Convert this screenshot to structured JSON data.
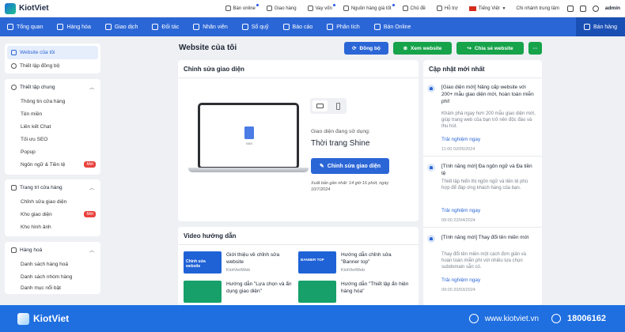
{
  "app": {
    "brand": "KiotViet"
  },
  "topbar": {
    "links": [
      {
        "label": "Bán online",
        "icon": "shop-icon",
        "dot": true
      },
      {
        "label": "Giao hàng",
        "icon": "truck-icon",
        "dot": false
      },
      {
        "label": "Vay vốn",
        "icon": "money-icon",
        "dot": true
      },
      {
        "label": "Nguồn hàng giá tốt",
        "icon": "source-icon",
        "dot": true
      },
      {
        "label": "Chủ đề",
        "icon": "palette-icon",
        "dot": false
      },
      {
        "label": "Hỗ trợ",
        "icon": "support-icon",
        "dot": false
      },
      {
        "label": "Tiếng Việt",
        "icon": "flag-vn-icon",
        "dot": false
      }
    ],
    "branch": "Chi nhánh trung tâm",
    "user": "admin"
  },
  "nav": {
    "items": [
      {
        "label": "Tổng quan",
        "icon": "eye-icon"
      },
      {
        "label": "Hàng hóa",
        "icon": "box-icon"
      },
      {
        "label": "Giao dịch",
        "icon": "transfer-icon"
      },
      {
        "label": "Đối tác",
        "icon": "partner-icon"
      },
      {
        "label": "Nhân viên",
        "icon": "staff-icon"
      },
      {
        "label": "Sổ quỹ",
        "icon": "wallet-icon"
      },
      {
        "label": "Báo cáo",
        "icon": "report-icon"
      },
      {
        "label": "Phân tích",
        "icon": "analytics-icon"
      },
      {
        "label": "Bán Online",
        "icon": "cart-icon"
      }
    ],
    "sell_button": "Bán hàng"
  },
  "sidebar": {
    "top_items": [
      {
        "label": "Website của tôi",
        "active": true
      },
      {
        "label": "Thiết lập đồng bộ",
        "active": false
      }
    ],
    "groups": [
      {
        "title": "Thiết lập chung",
        "items": [
          {
            "label": "Thông tin cửa hàng",
            "badge": ""
          },
          {
            "label": "Tên miền",
            "badge": ""
          },
          {
            "label": "Liên kết Chat",
            "badge": ""
          },
          {
            "label": "Tối ưu SEO",
            "badge": ""
          },
          {
            "label": "Popup",
            "badge": ""
          },
          {
            "label": "Ngôn ngữ & Tiền tệ",
            "badge": "Mới"
          }
        ]
      },
      {
        "title": "Trang trí cửa hàng",
        "items": [
          {
            "label": "Chỉnh sửa giao diện",
            "badge": ""
          },
          {
            "label": "Kho giao diện",
            "badge": "Mới"
          },
          {
            "label": "Kho hình ảnh",
            "badge": ""
          }
        ]
      },
      {
        "title": "Hàng hoá",
        "items": [
          {
            "label": "Danh sách hàng hoá",
            "badge": ""
          },
          {
            "label": "Danh sách nhóm hàng",
            "badge": ""
          },
          {
            "label": "Danh mục nổi bật",
            "badge": ""
          }
        ]
      }
    ]
  },
  "main": {
    "title": "Website của tôi",
    "buttons": {
      "sync": "Đồng bộ",
      "view": "Xem website",
      "share": "Chia sẻ website",
      "more": "···"
    },
    "editor": {
      "title": "Chỉnh sửa giao diện",
      "current_label": "Giao diện đang sử dụng:",
      "theme_name": "Thời trang Shine",
      "edit_button": "Chỉnh sửa giao diện",
      "published": "Xuất bản gần nhất: 14 giờ 16 phút, ngày 10/7/2024",
      "laptop_caption": "BBB"
    },
    "videos": {
      "title": "Video hướng dẫn",
      "items": [
        {
          "title": "Giới thiệu về chỉnh sửa website",
          "source": "KiotVietWeb",
          "thumb": "Chỉnh sửa website",
          "color": "#1f62d6"
        },
        {
          "title": "Hướng dẫn chỉnh sửa \"Banner top\"",
          "source": "KiotVietWeb",
          "thumb": "BANNER TOP",
          "color": "#1f62d6"
        },
        {
          "title": "Hướng dẫn \"Lựa chọn và ẩn dụng giao diện\"",
          "source": "",
          "thumb": "",
          "color": "#17a06a"
        },
        {
          "title": "Hướng dẫn \"Thiết lập ẩn hiện hàng hóa\"",
          "source": "",
          "thumb": "",
          "color": "#17a06a"
        }
      ]
    }
  },
  "news": {
    "title": "Cập nhật mới nhất",
    "items": [
      {
        "title": "[Giao diện mới] Nâng cấp website với 200+ mẫu giao diện mới, hoàn toàn miễn phí!",
        "desc": "Khám phá ngay hơn 200 mẫu giao diện mới, giúp trang web của bạn trở nên độc đáo và thu hút.",
        "link": "Trải nghiệm ngay",
        "time": "11:00 02/05/2024"
      },
      {
        "title": "[Tính năng mới] Đa ngôn ngữ và Đa tiền tệ",
        "desc": "Thiết lập hiển thị ngôn ngữ và tiền tệ phù hợp để đáp ứng khách hàng của bạn.",
        "link": "Trải nghiệm ngay",
        "time": "09:00 22/04/2024"
      },
      {
        "title": "[Tính năng mới] Thay đổi tên miền mới",
        "desc": "Thay đổi tên miền một cách đơn giản và hoàn toàn miễn phí với nhiều lựa chọn subdomain sẵn có.",
        "link": "Trải nghiệm ngay",
        "time": "09:00 20/03/2024"
      }
    ]
  },
  "footer": {
    "brand": "KiotViet",
    "website": "www.kiotviet.vn",
    "phone": "18006162"
  },
  "colors": {
    "primary": "#2b66d6",
    "green": "#16a34a",
    "footer": "#1f6fe0"
  }
}
